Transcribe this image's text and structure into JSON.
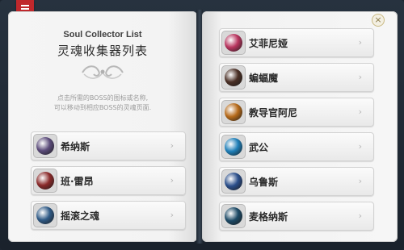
{
  "title_en": "Soul Collector List",
  "title_cn": "灵魂收集器列表",
  "description_line1": "点击所需的BOSS的图标或名称,",
  "description_line2": "可以移动到相应BOSS的灵魂页面.",
  "close_glyph": "×",
  "arrow_glyph": "›",
  "left_items": [
    {
      "label": "希纳斯",
      "icon": "cygnus-portrait-icon",
      "color": "#5b4b7a"
    },
    {
      "label": "班·雷昂",
      "icon": "von-leon-portrait-icon",
      "color": "#8a2a2a"
    },
    {
      "label": "摇滚之魂",
      "icon": "rock-spirit-portrait-icon",
      "color": "#2f5a86"
    }
  ],
  "right_items": [
    {
      "label": "艾菲尼娅",
      "icon": "ephenia-portrait-icon",
      "color": "#b8345e"
    },
    {
      "label": "蝙蝠魔",
      "icon": "bat-demon-portrait-icon",
      "color": "#4a2f25"
    },
    {
      "label": "教导官阿尼",
      "icon": "instructor-arkarium-portrait-icon",
      "color": "#b66a1a"
    },
    {
      "label": "武公",
      "icon": "mu-gong-portrait-icon",
      "color": "#1f7fb8"
    },
    {
      "label": "乌鲁斯",
      "icon": "urus-portrait-icon",
      "color": "#2a4e8a"
    },
    {
      "label": "麦格纳斯",
      "icon": "magnus-portrait-icon",
      "color": "#1d4a66"
    }
  ]
}
